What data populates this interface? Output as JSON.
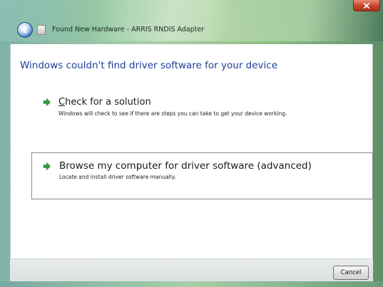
{
  "window": {
    "title": "Found New Hardware - ARRIS RNDIS Adapter",
    "close_icon": "close-icon",
    "back_icon": "back-arrow-icon",
    "device_icon": "hardware-device-icon",
    "colors": {
      "heading": "#1f3f99",
      "arrow": "#2ea043",
      "close": "#c7452c",
      "frame": "#9fcda6"
    }
  },
  "main": {
    "heading": "Windows couldn't find driver software for your device",
    "options": [
      {
        "title_accel": "C",
        "title_rest": "heck for a solution",
        "description": "Windows will check to see if there are steps you can take to get your device working.",
        "icon": "green-arrow-icon"
      },
      {
        "title": "Browse my computer for driver software (advanced)",
        "description": "Locate and install driver software manually.",
        "icon": "green-arrow-icon"
      }
    ]
  },
  "footer": {
    "cancel_label": "Cancel"
  }
}
